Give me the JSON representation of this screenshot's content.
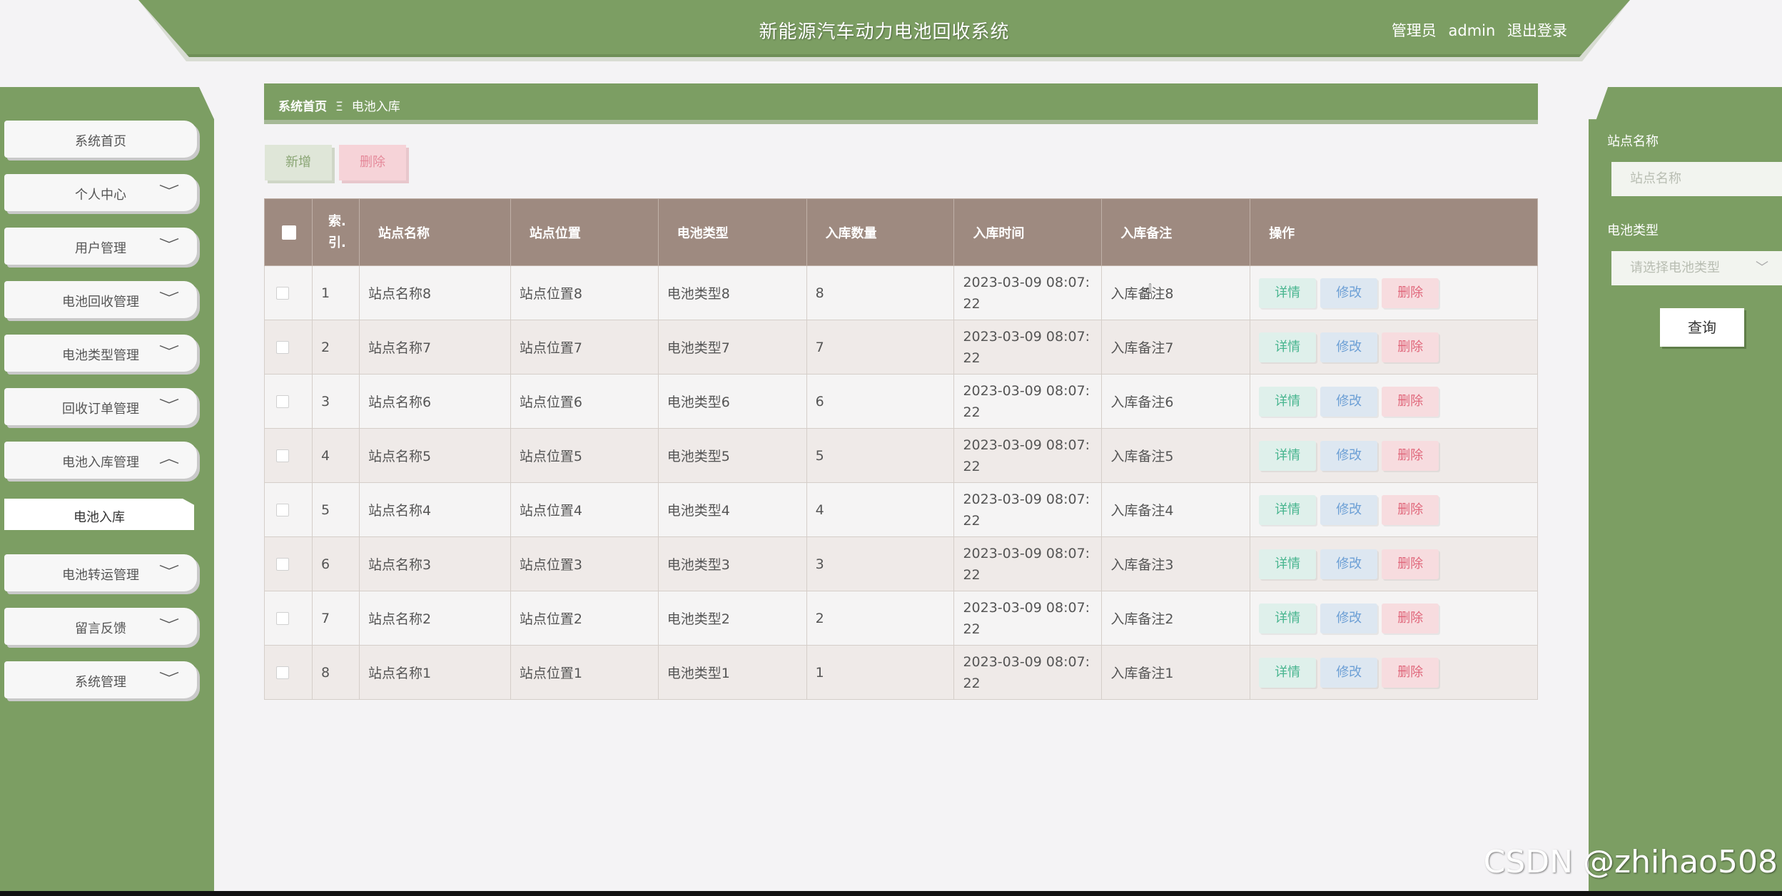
{
  "header": {
    "title": "新能源汽车动力电池回收系统",
    "role": "管理员",
    "username": "admin",
    "logout_label": "退出登录"
  },
  "sidebar": {
    "items": [
      {
        "label": "系统首页",
        "expandable": false
      },
      {
        "label": "个人中心",
        "expandable": true,
        "chevron": "﹀"
      },
      {
        "label": "用户管理",
        "expandable": true,
        "chevron": "﹀"
      },
      {
        "label": "电池回收管理",
        "expandable": true,
        "chevron": "﹀"
      },
      {
        "label": "电池类型管理",
        "expandable": true,
        "chevron": "﹀"
      },
      {
        "label": "回收订单管理",
        "expandable": true,
        "chevron": "﹀"
      },
      {
        "label": "电池入库管理",
        "expandable": true,
        "chevron": "︿"
      },
      {
        "label": "电池转运管理",
        "expandable": true,
        "chevron": "﹀"
      },
      {
        "label": "留言反馈",
        "expandable": true,
        "chevron": "﹀"
      },
      {
        "label": "系统管理",
        "expandable": true,
        "chevron": "﹀"
      }
    ],
    "subitem": "电池入库"
  },
  "breadcrumb": {
    "home": "系统首页",
    "separator": "Ξ",
    "current": "电池入库"
  },
  "toolbar": {
    "add_label": "新增",
    "delete_label": "删除"
  },
  "table": {
    "headers": [
      "索引",
      "站点名称",
      "站点位置",
      "电池类型",
      "入库数量",
      "入库时间",
      "入库备注",
      "操作"
    ],
    "index_header_top": "索.",
    "index_header_bottom": "引.",
    "rows": [
      {
        "index": "1",
        "name": "站点名称8",
        "location": "站点位置8",
        "type": "电池类型8",
        "qty": "8",
        "time": "2023-03-09 08:07:22",
        "note": "入库备注8"
      },
      {
        "index": "2",
        "name": "站点名称7",
        "location": "站点位置7",
        "type": "电池类型7",
        "qty": "7",
        "time": "2023-03-09 08:07:22",
        "note": "入库备注7"
      },
      {
        "index": "3",
        "name": "站点名称6",
        "location": "站点位置6",
        "type": "电池类型6",
        "qty": "6",
        "time": "2023-03-09 08:07:22",
        "note": "入库备注6"
      },
      {
        "index": "4",
        "name": "站点名称5",
        "location": "站点位置5",
        "type": "电池类型5",
        "qty": "5",
        "time": "2023-03-09 08:07:22",
        "note": "入库备注5"
      },
      {
        "index": "5",
        "name": "站点名称4",
        "location": "站点位置4",
        "type": "电池类型4",
        "qty": "4",
        "time": "2023-03-09 08:07:22",
        "note": "入库备注4"
      },
      {
        "index": "6",
        "name": "站点名称3",
        "location": "站点位置3",
        "type": "电池类型3",
        "qty": "3",
        "time": "2023-03-09 08:07:22",
        "note": "入库备注3"
      },
      {
        "index": "7",
        "name": "站点名称2",
        "location": "站点位置2",
        "type": "电池类型2",
        "qty": "2",
        "time": "2023-03-09 08:07:22",
        "note": "入库备注2"
      },
      {
        "index": "8",
        "name": "站点名称1",
        "location": "站点位置1",
        "type": "电池类型1",
        "qty": "1",
        "time": "2023-03-09 08:07:22",
        "note": "入库备注1"
      }
    ],
    "actions": {
      "detail": "详情",
      "edit": "修改",
      "delete": "删除"
    }
  },
  "search_panel": {
    "station_label": "站点名称",
    "station_placeholder": "站点名称",
    "battery_label": "电池类型",
    "battery_placeholder": "请选择电池类型",
    "query_label": "查询"
  },
  "watermark": "CSDN @zhihao508",
  "colors": {
    "primary": "#7c9e63",
    "table_header": "#9e8a80",
    "detail": "#48b58f",
    "edit": "#6c9fd5",
    "delete": "#e0667a"
  }
}
